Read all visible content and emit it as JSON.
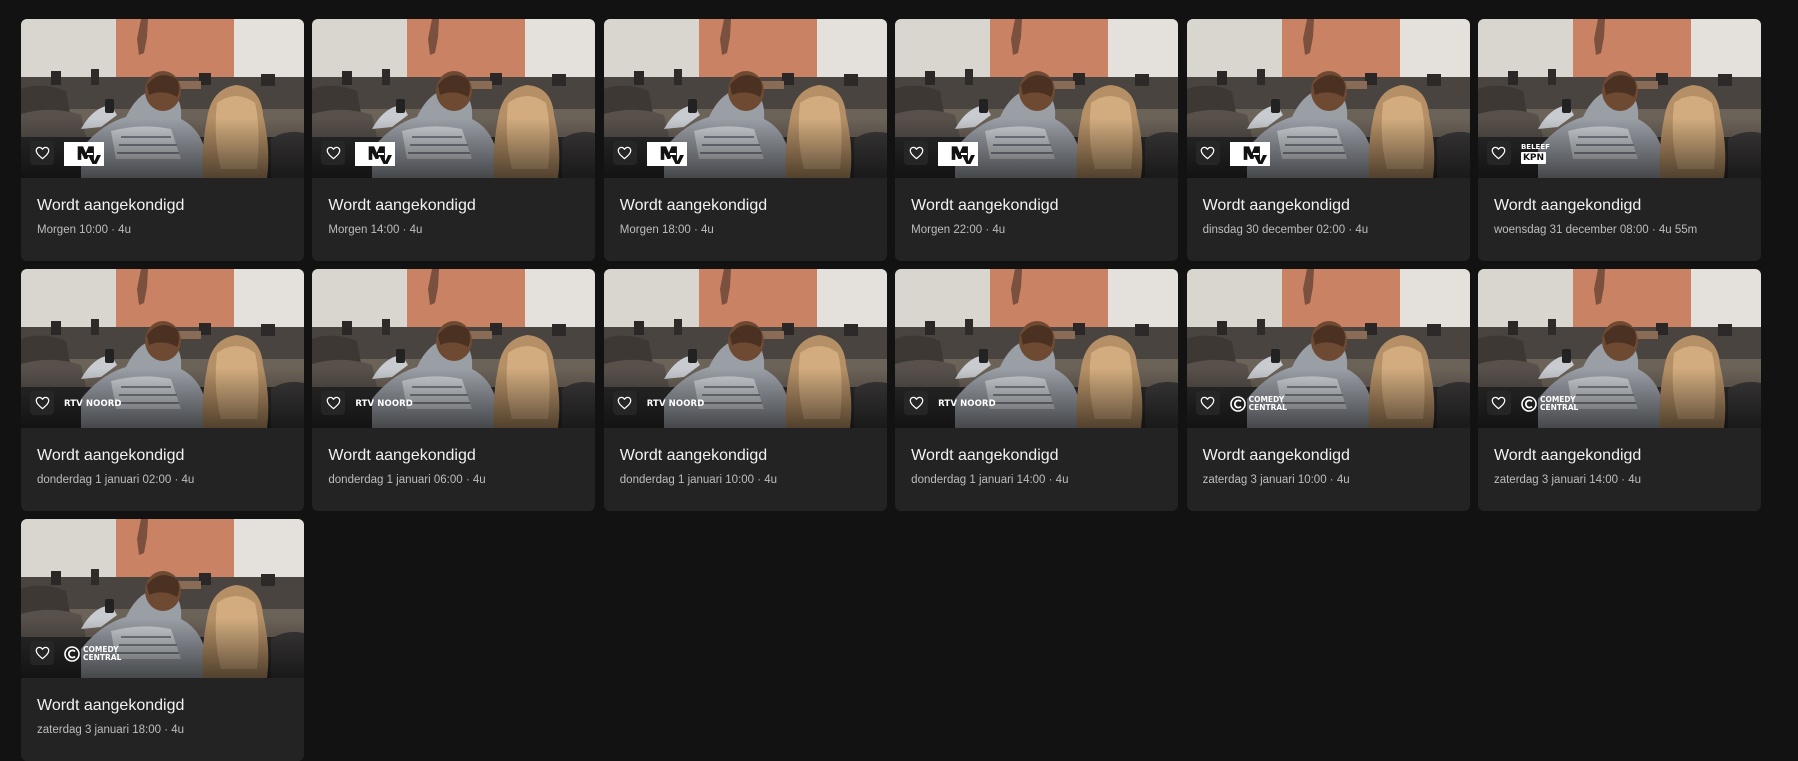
{
  "programs": [
    {
      "title": "Wordt aangekondigd",
      "time": "Morgen 10:00 · 4u",
      "channel": "MTV",
      "channel_logo": "mtv"
    },
    {
      "title": "Wordt aangekondigd",
      "time": "Morgen 14:00 · 4u",
      "channel": "MTV",
      "channel_logo": "mtv"
    },
    {
      "title": "Wordt aangekondigd",
      "time": "Morgen 18:00 · 4u",
      "channel": "MTV",
      "channel_logo": "mtv"
    },
    {
      "title": "Wordt aangekondigd",
      "time": "Morgen 22:00 · 4u",
      "channel": "MTV",
      "channel_logo": "mtv"
    },
    {
      "title": "Wordt aangekondigd",
      "time": "dinsdag 30 december 02:00 · 4u",
      "channel": "MTV",
      "channel_logo": "mtv"
    },
    {
      "title": "Wordt aangekondigd",
      "time": "woensdag 31 december 08:00 · 4u 55m",
      "channel": "BELEEF KPN",
      "channel_logo": "kpn",
      "logo_lines": [
        "BELEEF",
        "KPN"
      ]
    },
    {
      "title": "Wordt aangekondigd",
      "time": "donderdag 1 januari 02:00 · 4u",
      "channel": "RTV NOORD",
      "channel_logo": "rtv"
    },
    {
      "title": "Wordt aangekondigd",
      "time": "donderdag 1 januari 06:00 · 4u",
      "channel": "RTV NOORD",
      "channel_logo": "rtv"
    },
    {
      "title": "Wordt aangekondigd",
      "time": "donderdag 1 januari 10:00 · 4u",
      "channel": "RTV NOORD",
      "channel_logo": "rtv"
    },
    {
      "title": "Wordt aangekondigd",
      "time": "donderdag 1 januari 14:00 · 4u",
      "channel": "RTV NOORD",
      "channel_logo": "rtv"
    },
    {
      "title": "Wordt aangekondigd",
      "time": "zaterdag 3 januari 10:00 · 4u",
      "channel": "COMEDY CENTRAL",
      "channel_logo": "comedy-central",
      "logo_lines": [
        "COMEDY",
        "CENTRAL"
      ]
    },
    {
      "title": "Wordt aangekondigd",
      "time": "zaterdag 3 januari 14:00 · 4u",
      "channel": "COMEDY CENTRAL",
      "channel_logo": "comedy-central",
      "logo_lines": [
        "COMEDY",
        "CENTRAL"
      ]
    },
    {
      "title": "Wordt aangekondigd",
      "time": "zaterdag 3 januari 18:00 · 4u",
      "channel": "COMEDY CENTRAL",
      "channel_logo": "comedy-central",
      "logo_lines": [
        "COMEDY",
        "CENTRAL"
      ]
    }
  ],
  "icons": {
    "favorite": "heart-outline-icon",
    "thumbnail": "couple-watching-tv-image"
  },
  "colors": {
    "background": "#121212",
    "card": "#232323",
    "title": "#f2f2f2",
    "meta": "#bdbdbd"
  }
}
